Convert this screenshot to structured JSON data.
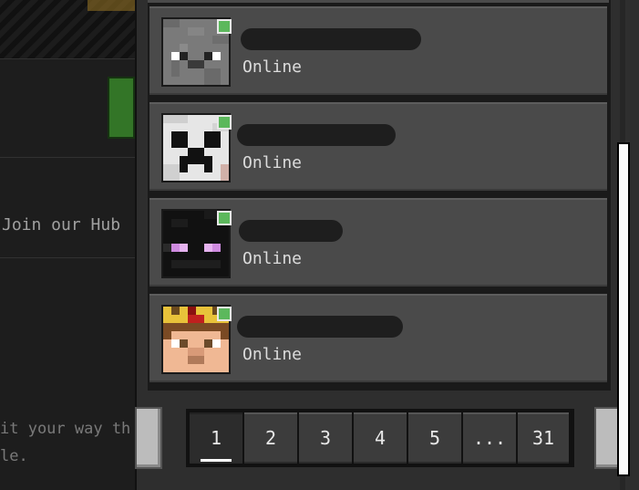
{
  "background": {
    "hub_text": "Join our Hub",
    "description_line1": "it your way th",
    "description_line2": "le."
  },
  "friends": [
    {
      "status": "Online",
      "avatar": "gray-face-avatar",
      "status_color": "#5cb85c"
    },
    {
      "status": "Online",
      "avatar": "creeper-face-avatar",
      "status_color": "#5cb85c"
    },
    {
      "status": "Online",
      "avatar": "enderman-face-avatar",
      "status_color": "#5cb85c"
    },
    {
      "status": "Online",
      "avatar": "crowned-face-avatar",
      "status_color": "#5cb85c"
    }
  ],
  "pagination": {
    "pages": [
      "1",
      "2",
      "3",
      "4",
      "5",
      "...",
      "31"
    ],
    "current": "1"
  },
  "colors": {
    "panel": "#2e2e2e",
    "card": "#4a4a4a",
    "online_dot": "#5cb85c"
  }
}
